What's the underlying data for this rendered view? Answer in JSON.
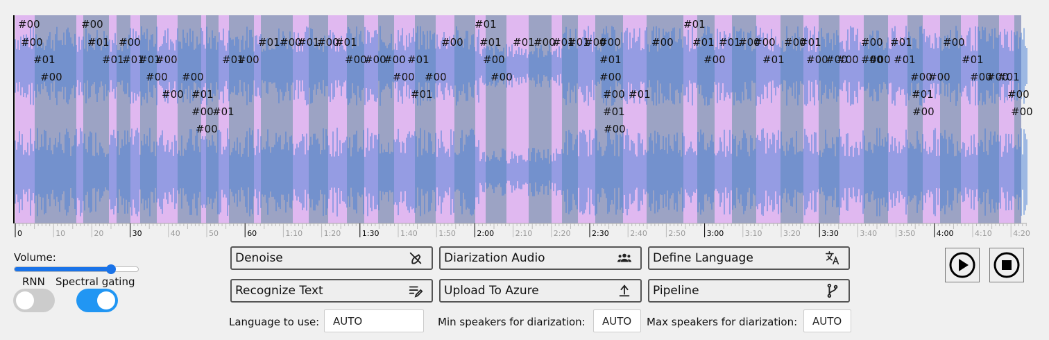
{
  "timeline": {
    "tick_labels": [
      "0",
      "10",
      "20",
      "30",
      "40",
      "50",
      "60",
      "1:10",
      "1:20",
      "1:30",
      "1:40",
      "1:50",
      "2:00",
      "2:10",
      "2:20",
      "2:30",
      "2:40",
      "2:50",
      "3:00",
      "3:10",
      "3:20",
      "3:30",
      "3:40",
      "3:50",
      "4:00",
      "4:10",
      "4:20"
    ],
    "major_labels": [
      "0",
      "30",
      "60",
      "1:30",
      "2:00",
      "2:30",
      "3:00",
      "3:30",
      "4:00"
    ],
    "speaker_labels": [
      "#00",
      "#01"
    ]
  },
  "volume": {
    "label": "Volume:",
    "value_percent": 78
  },
  "toggles": {
    "rnn": {
      "label": "RNN",
      "on": false
    },
    "spectral": {
      "label": "Spectral gating",
      "on": true
    }
  },
  "buttons": {
    "denoise": "Denoise",
    "diarization": "Diarization Audio",
    "define_language": "Define Language",
    "recognize": "Recognize Text",
    "upload": "Upload To Azure",
    "pipeline": "Pipeline"
  },
  "fields": {
    "language_label": "Language to use:",
    "language_value": "AUTO",
    "min_label": "Min speakers for diarization:",
    "min_value": "AUTO",
    "max_label": "Max speakers for diarization:",
    "max_value": "AUTO"
  },
  "colors": {
    "accent": "#2196f3",
    "wave": "#4a7fd6",
    "speaker0": "#9ca3c4",
    "speaker1": "#e0b8f0",
    "toggle_off": "#cccccc"
  }
}
